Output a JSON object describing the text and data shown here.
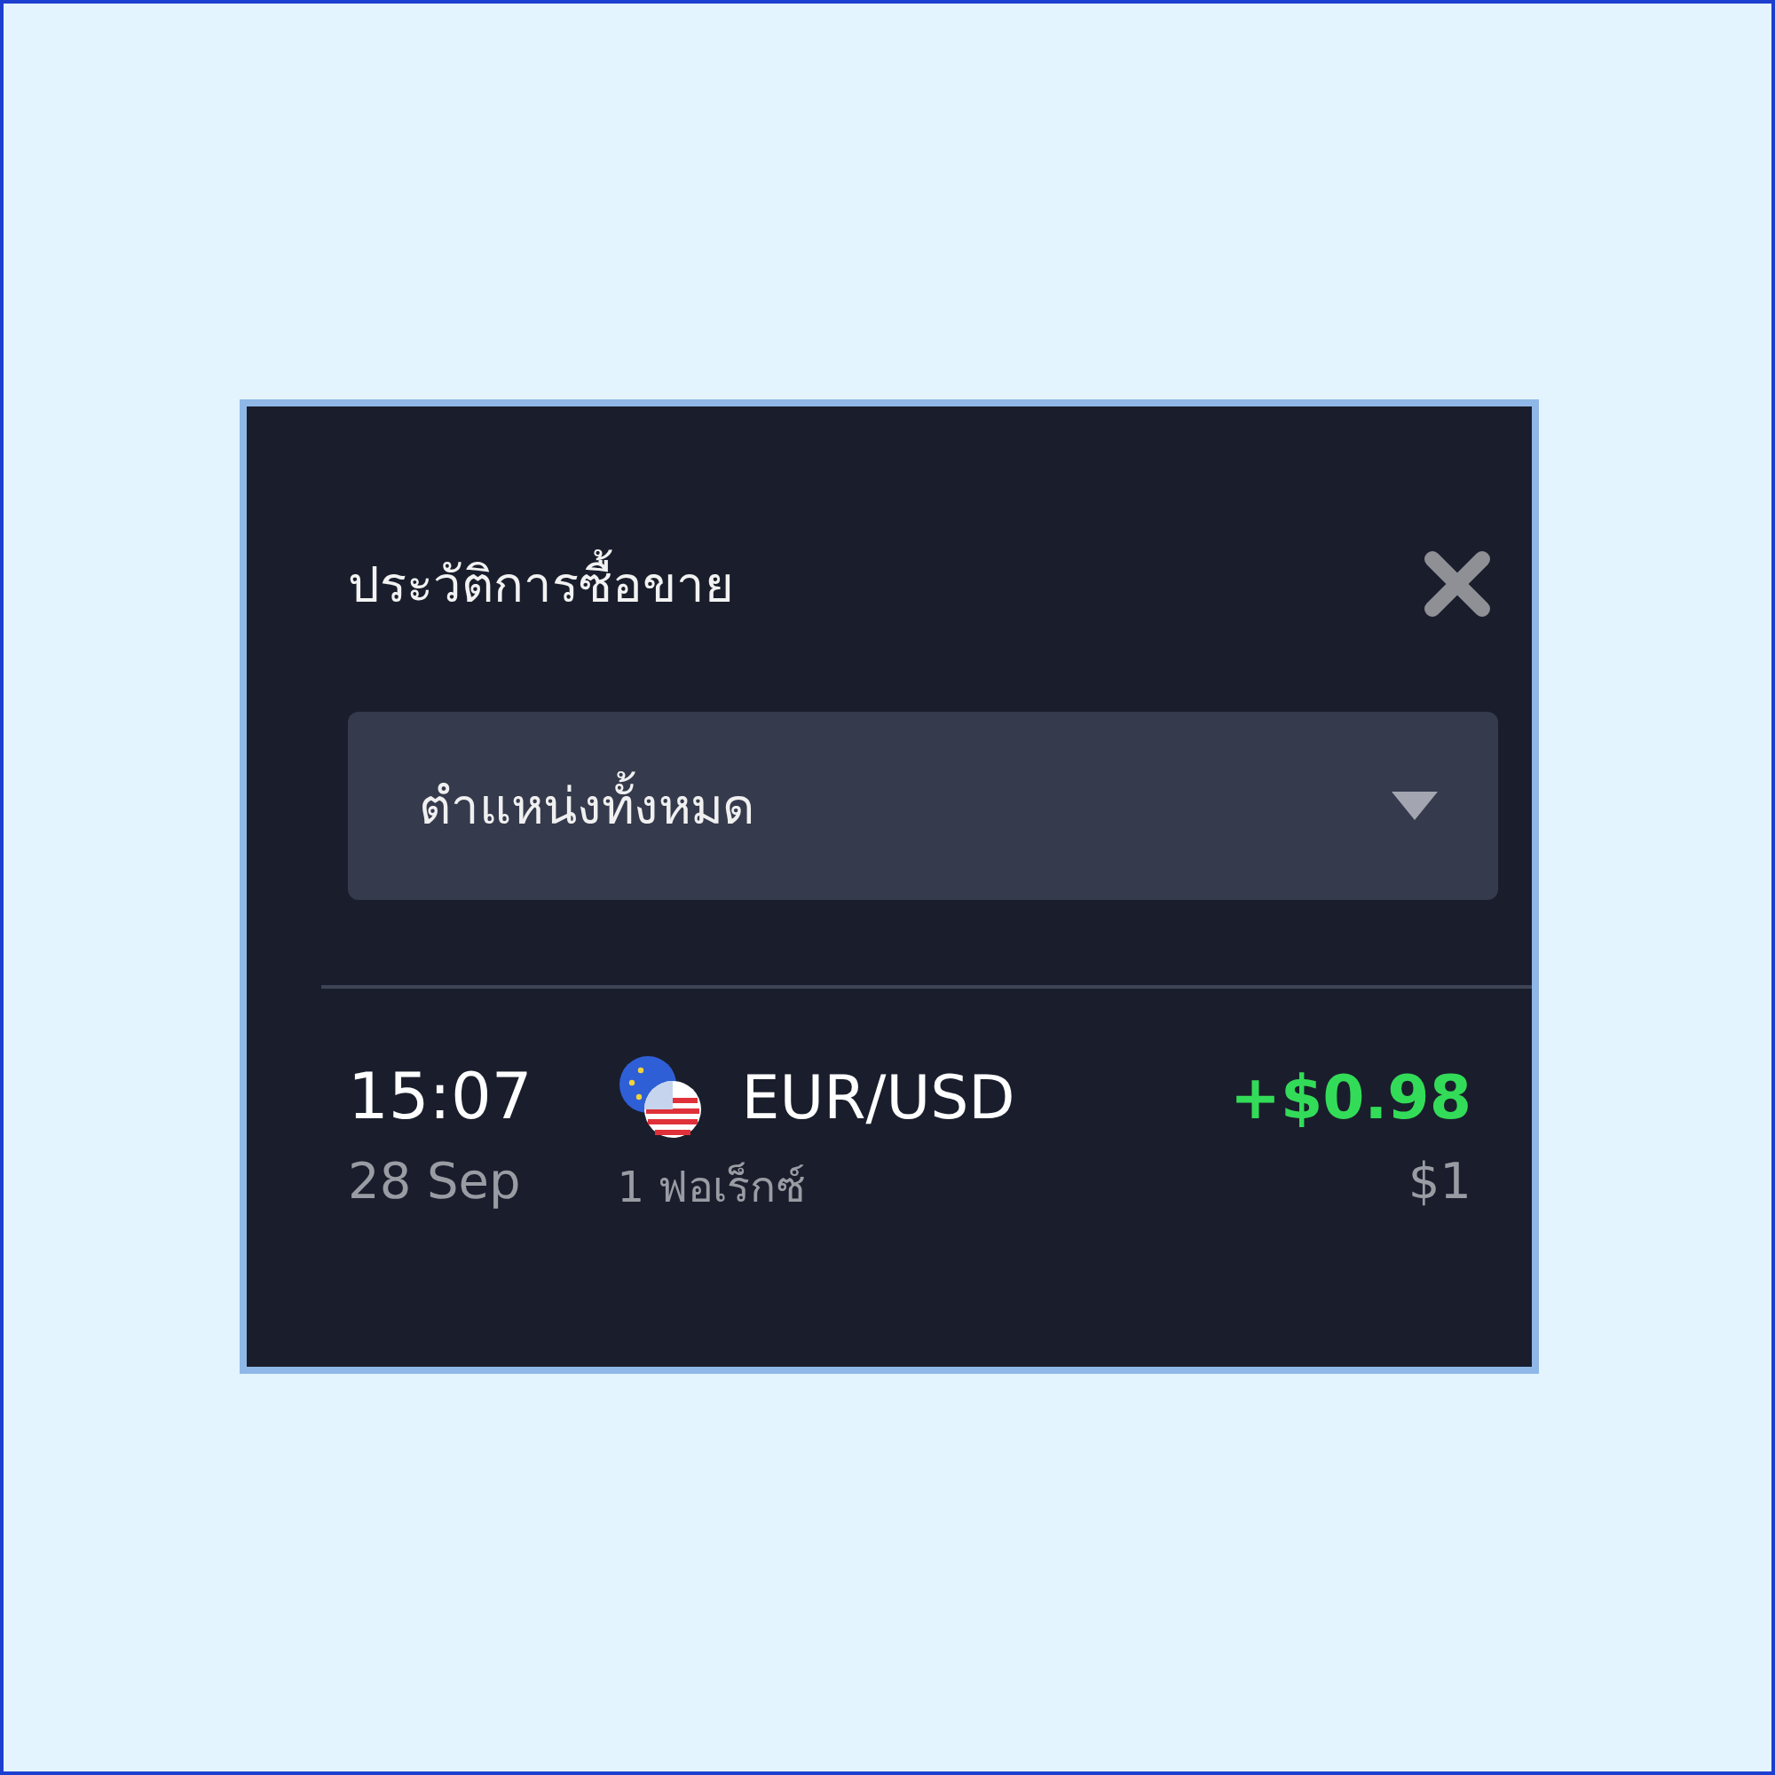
{
  "panel": {
    "title": "ประวัติการซื้อขาย"
  },
  "filter": {
    "value": "ตำแหน่งทั้งหมด"
  },
  "trades": [
    {
      "time": "15:07",
      "date": "28 Sep",
      "pair": "EUR/USD",
      "type": "1 ฟอเร็กซ์",
      "profit": "+$0.98",
      "profit_positive": true,
      "amount": "$1"
    }
  ]
}
